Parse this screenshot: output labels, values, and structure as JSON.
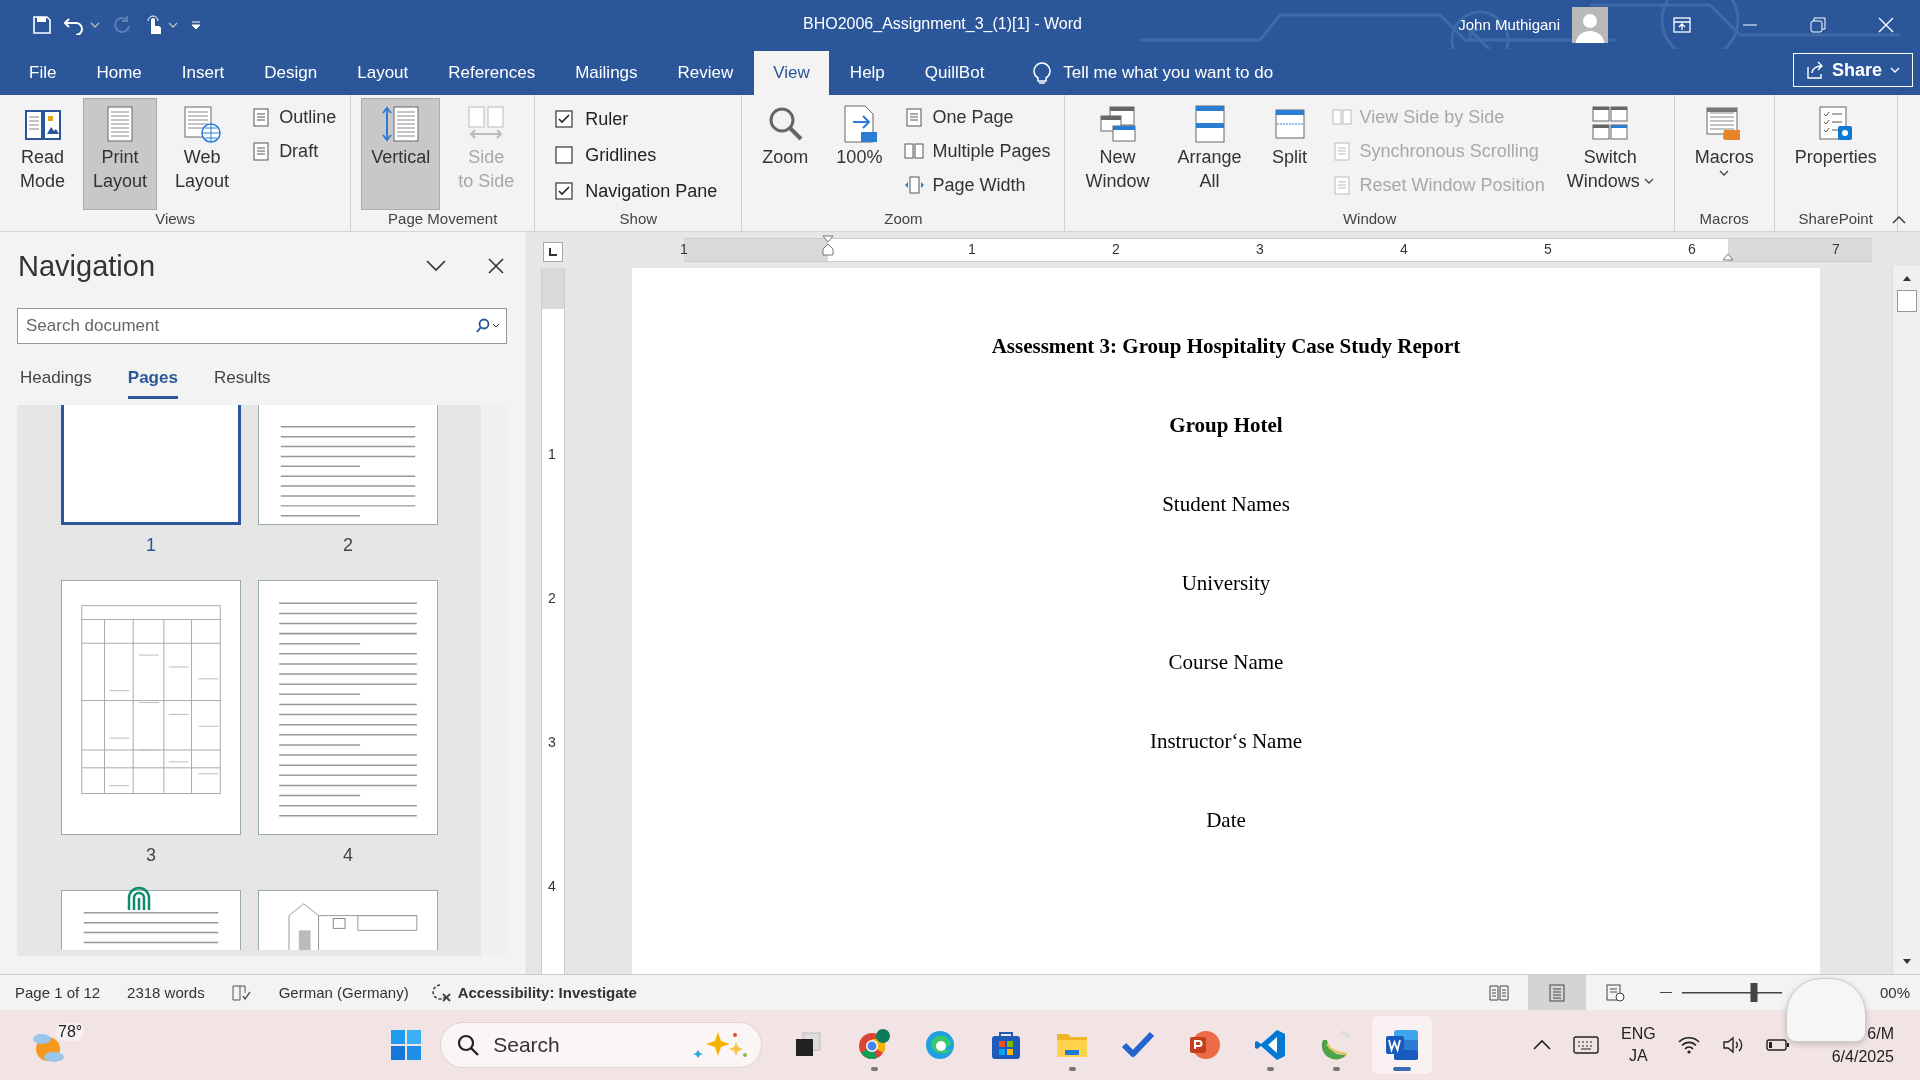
{
  "window": {
    "title": "BHO2006_Assignment_3_(1)[1]  -  Word",
    "user": "John Muthigani"
  },
  "menu_tabs": [
    {
      "label": "File",
      "selected": false
    },
    {
      "label": "Home",
      "selected": false
    },
    {
      "label": "Insert",
      "selected": false
    },
    {
      "label": "Design",
      "selected": false
    },
    {
      "label": "Layout",
      "selected": false
    },
    {
      "label": "References",
      "selected": false
    },
    {
      "label": "Mailings",
      "selected": false
    },
    {
      "label": "Review",
      "selected": false
    },
    {
      "label": "View",
      "selected": true
    },
    {
      "label": "Help",
      "selected": false
    },
    {
      "label": "QuillBot",
      "selected": false
    }
  ],
  "tell_me": {
    "placeholder": "Tell me what you want to do"
  },
  "share_button": "Share",
  "ribbon_groups": [
    {
      "label": "Views",
      "items": [
        {
          "kind": "large",
          "lines": [
            "Read",
            "Mode"
          ],
          "selected": false
        },
        {
          "kind": "large",
          "lines": [
            "Print",
            "Layout"
          ],
          "selected": true
        },
        {
          "kind": "large",
          "lines": [
            "Web",
            "Layout"
          ],
          "selected": false
        },
        {
          "kind": "stack",
          "items": [
            "Outline",
            "Draft"
          ]
        }
      ]
    },
    {
      "label": "Page Movement",
      "items": [
        {
          "kind": "large",
          "lines": [
            "Vertical"
          ],
          "selected": true
        },
        {
          "kind": "large",
          "lines": [
            "Side",
            "to Side"
          ],
          "selected": false,
          "disabled": true
        }
      ]
    },
    {
      "label": "Show",
      "items": [
        {
          "kind": "checks",
          "items": [
            {
              "label": "Ruler",
              "checked": true
            },
            {
              "label": "Gridlines",
              "checked": false
            },
            {
              "label": "Navigation Pane",
              "checked": true
            }
          ]
        }
      ]
    },
    {
      "label": "Zoom",
      "items": [
        {
          "kind": "large",
          "lines": [
            "Zoom"
          ],
          "selected": false
        },
        {
          "kind": "large",
          "lines": [
            "100%"
          ],
          "selected": false
        },
        {
          "kind": "stack",
          "items": [
            "One Page",
            "Multiple Pages",
            "Page Width"
          ]
        }
      ]
    },
    {
      "label": "Window",
      "items": [
        {
          "kind": "large",
          "lines": [
            "New",
            "Window"
          ],
          "selected": false
        },
        {
          "kind": "large",
          "lines": [
            "Arrange",
            "All"
          ],
          "selected": false
        },
        {
          "kind": "large",
          "lines": [
            "Split"
          ],
          "selected": false
        },
        {
          "kind": "stack",
          "disabled": true,
          "items": [
            "View Side by Side",
            "Synchronous Scrolling",
            "Reset Window Position"
          ]
        },
        {
          "kind": "large",
          "lines": [
            "Switch",
            "Windows"
          ],
          "selected": false,
          "dropdown": true
        }
      ]
    },
    {
      "label": "Macros",
      "items": [
        {
          "kind": "large",
          "lines": [
            "Macros"
          ],
          "selected": false,
          "dropdown": true
        }
      ]
    },
    {
      "label": "SharePoint",
      "items": [
        {
          "kind": "large",
          "lines": [
            "Properties"
          ],
          "selected": false
        }
      ]
    }
  ],
  "navigation": {
    "title": "Navigation",
    "search": {
      "placeholder": "Search document"
    },
    "tabs": [
      {
        "label": "Headings",
        "selected": false
      },
      {
        "label": "Pages",
        "selected": true
      },
      {
        "label": "Results",
        "selected": false
      }
    ],
    "pages": [
      {
        "number": "1",
        "selected": true,
        "kind": "blank"
      },
      {
        "number": "2",
        "selected": false,
        "kind": "text"
      },
      {
        "number": "3",
        "selected": false,
        "kind": "table"
      },
      {
        "number": "4",
        "selected": false,
        "kind": "text"
      },
      {
        "selected": false,
        "kind": "text"
      },
      {
        "selected": false,
        "kind": "figure"
      }
    ]
  },
  "ruler": {
    "horizontal": [
      "1",
      "1",
      "2",
      "3",
      "4",
      "5",
      "6",
      "7"
    ],
    "vertical": [
      "1",
      "2",
      "3",
      "4"
    ]
  },
  "document": {
    "paragraphs": [
      {
        "text": "Assessment 3: Group Hospitality Case Study Report",
        "bold": true
      },
      {
        "text": "Group Hotel",
        "bold": true
      },
      {
        "text": "Student Names",
        "bold": false
      },
      {
        "text": "University",
        "bold": false
      },
      {
        "text": "Course Name",
        "bold": false
      },
      {
        "text": "Instructor‘s Name",
        "bold": false
      },
      {
        "text": "Date",
        "bold": false
      }
    ]
  },
  "status_bar": {
    "page": "Page 1 of 12",
    "words": "2318 words",
    "language": "German (Germany)",
    "accessibility": "Accessibility: Investigate",
    "views": [
      {
        "selected": false
      },
      {
        "selected": true
      },
      {
        "selected": false
      }
    ],
    "zoom_slider": {
      "level": 0.72
    },
    "zoom": "00%"
  },
  "taskbar": {
    "weather": "78°",
    "search": {
      "placeholder": "Search"
    },
    "apps": [
      {
        "running": false,
        "selected": false
      },
      {
        "running": true,
        "selected": false
      },
      {
        "running": false,
        "selected": false
      },
      {
        "running": false,
        "selected": false
      },
      {
        "running": true,
        "selected": false
      },
      {
        "running": false,
        "selected": false
      },
      {
        "running": false,
        "selected": false
      },
      {
        "running": true,
        "selected": false
      },
      {
        "running": true,
        "selected": false
      },
      {
        "running": true,
        "selected": true
      }
    ],
    "language": [
      "ENG",
      "JA"
    ],
    "time": "6/M",
    "date": "6/4/2025"
  }
}
